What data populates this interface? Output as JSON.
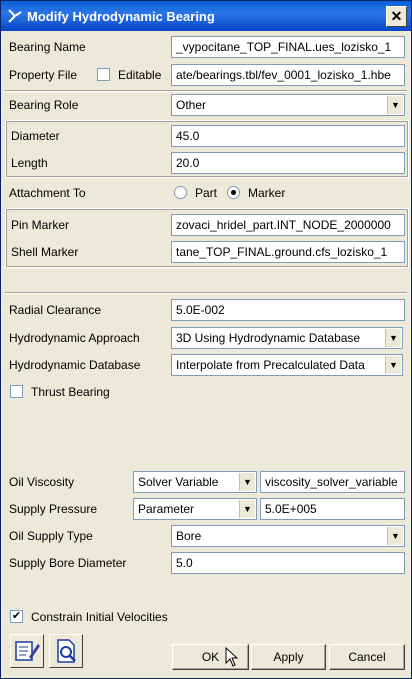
{
  "window": {
    "title": "Modify Hydrodynamic Bearing"
  },
  "bearing_name": {
    "label": "Bearing Name",
    "value": "_vypocitane_TOP_FINAL.ues_lozisko_1"
  },
  "property_file": {
    "label": "Property File",
    "editable_label": "Editable",
    "editable_checked": false,
    "value": "ate/bearings.tbl/fev_0001_lozisko_1.hbe"
  },
  "bearing_role": {
    "label": "Bearing Role",
    "value": "Other"
  },
  "diameter": {
    "label": "Diameter",
    "value": "45.0"
  },
  "length": {
    "label": "Length",
    "value": "20.0"
  },
  "attachment": {
    "label": "Attachment To",
    "option_part": "Part",
    "option_marker": "Marker",
    "selected": "Marker"
  },
  "pin_marker": {
    "label": "Pin Marker",
    "value": "zovaci_hridel_part.INT_NODE_2000000"
  },
  "shell_marker": {
    "label": "Shell Marker",
    "value": "tane_TOP_FINAL.ground.cfs_lozisko_1"
  },
  "radial_clearance": {
    "label": "Radial Clearance",
    "value": "5.0E-002"
  },
  "hydro_approach": {
    "label": "Hydrodynamic Approach",
    "value": "3D Using Hydrodynamic Database"
  },
  "hydro_database": {
    "label": "Hydrodynamic Database",
    "value": "Interpolate from Precalculated Data"
  },
  "thrust_bearing": {
    "label": "Thrust Bearing",
    "checked": false
  },
  "oil_viscosity": {
    "label": "Oil Viscosity",
    "type": "Solver Variable",
    "value": "viscosity_solver_variable"
  },
  "supply_pressure": {
    "label": "Supply Pressure",
    "type": "Parameter",
    "value": "5.0E+005"
  },
  "oil_supply_type": {
    "label": "Oil Supply Type",
    "value": "Bore"
  },
  "supply_bore_diameter": {
    "label": "Supply Bore Diameter",
    "value": "5.0"
  },
  "constrain": {
    "label": "Constrain Initial Velocities",
    "checked": true
  },
  "buttons": {
    "ok": "OK",
    "apply": "Apply",
    "cancel": "Cancel"
  }
}
